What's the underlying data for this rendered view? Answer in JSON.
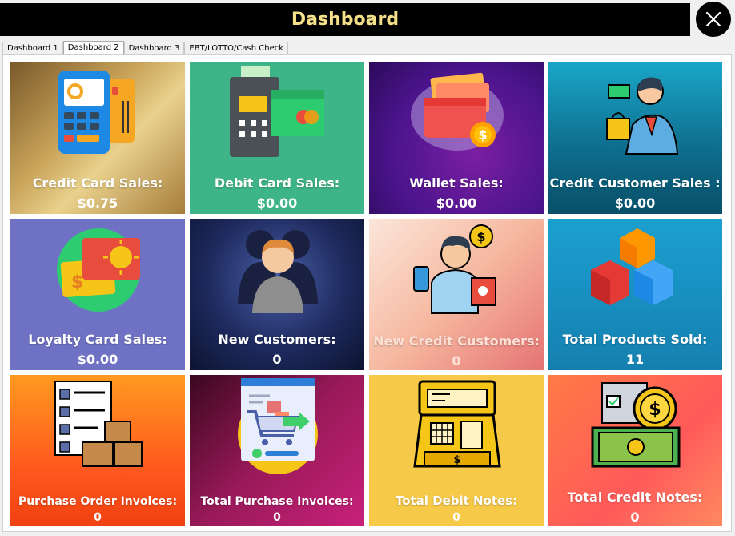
{
  "window": {
    "title": "Dashboard"
  },
  "tabs": [
    {
      "label": "Dashboard 1"
    },
    {
      "label": "Dashboard 2"
    },
    {
      "label": "Dashboard 3"
    },
    {
      "label": "EBT/LOTTO/Cash Check"
    }
  ],
  "tiles": [
    {
      "label": "Credit Card Sales:",
      "value": "$0.75"
    },
    {
      "label": "Debit Card Sales:",
      "value": "$0.00"
    },
    {
      "label": "Wallet Sales:",
      "value": "$0.00"
    },
    {
      "label": "Credit Customer Sales :",
      "value": "$0.00"
    },
    {
      "label": "Loyalty Card Sales:",
      "value": "$0.00"
    },
    {
      "label": "New Customers:",
      "value": "0"
    },
    {
      "label": "New Credit Customers:",
      "value": "0"
    },
    {
      "label": "Total Products Sold:",
      "value": "11"
    },
    {
      "label": "Purchase Order Invoices:",
      "value": "0"
    },
    {
      "label": "Total Purchase Invoices:",
      "value": "0"
    },
    {
      "label": "Total Debit Notes:",
      "value": "0"
    },
    {
      "label": "Total Credit Notes:",
      "value": "0"
    }
  ]
}
